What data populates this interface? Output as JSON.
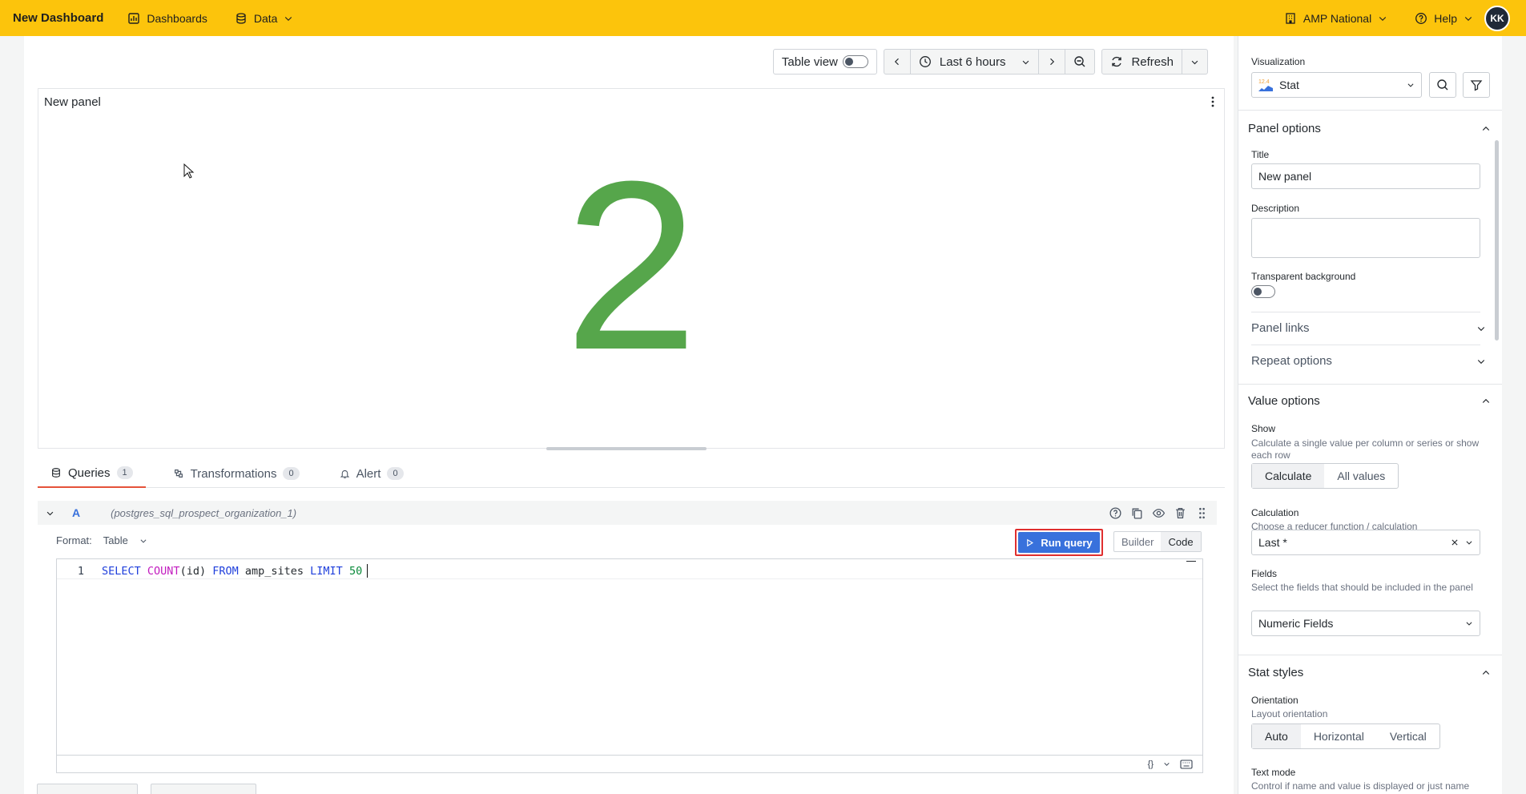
{
  "topbar": {
    "brand": "New Dashboard",
    "nav": [
      {
        "label": "Dashboards",
        "icon": "dashboard-icon"
      },
      {
        "label": "Data",
        "icon": "database-icon"
      }
    ],
    "org": "AMP National",
    "help": "Help",
    "avatar": "KK",
    "background": "#fcc40c"
  },
  "toolbar": {
    "table_view": "Table view",
    "time_range": "Last 6 hours",
    "refresh": "Refresh"
  },
  "panel": {
    "title": "New panel",
    "stat_value": "2",
    "stat_color": "#56a64b"
  },
  "tabs": [
    {
      "label": "Queries",
      "count": "1"
    },
    {
      "label": "Transformations",
      "count": "0"
    },
    {
      "label": "Alert",
      "count": "0"
    }
  ],
  "query": {
    "ref": "A",
    "datasource": "(postgres_sql_prospect_organization_1)",
    "format_label": "Format:",
    "format_value": "Table",
    "run_label": "Run query",
    "builder_label": "Builder",
    "code_label": "Code",
    "line_no": "1",
    "sql": {
      "select": "SELECT",
      "count": "COUNT",
      "args": "(id)",
      "from": "FROM",
      "table": "amp_sites",
      "limit": "LIMIT",
      "limit_val": "50"
    },
    "footer_braces": "{}"
  },
  "sidebar": {
    "visualization_label": "Visualization",
    "visualization_value": "Stat",
    "viz_icon_text": "12.4",
    "panel_options": "Panel options",
    "title_label": "Title",
    "title_value": "New panel",
    "description_label": "Description",
    "transparent_label": "Transparent background",
    "panel_links": "Panel links",
    "repeat_options": "Repeat options",
    "value_options": "Value options",
    "show_label": "Show",
    "show_desc": "Calculate a single value per column or series or show each row",
    "show_calculate": "Calculate",
    "show_all": "All values",
    "calc_label": "Calculation",
    "calc_desc": "Choose a reducer function / calculation",
    "calc_value": "Last *",
    "fields_label": "Fields",
    "fields_desc": "Select the fields that should be included in the panel",
    "fields_value": "Numeric Fields",
    "stat_styles": "Stat styles",
    "orientation_label": "Orientation",
    "orientation_desc": "Layout orientation",
    "orient_auto": "Auto",
    "orient_horizontal": "Horizontal",
    "orient_vertical": "Vertical",
    "text_mode_label": "Text mode",
    "text_mode_desc": "Control if name and value is displayed or just name"
  }
}
